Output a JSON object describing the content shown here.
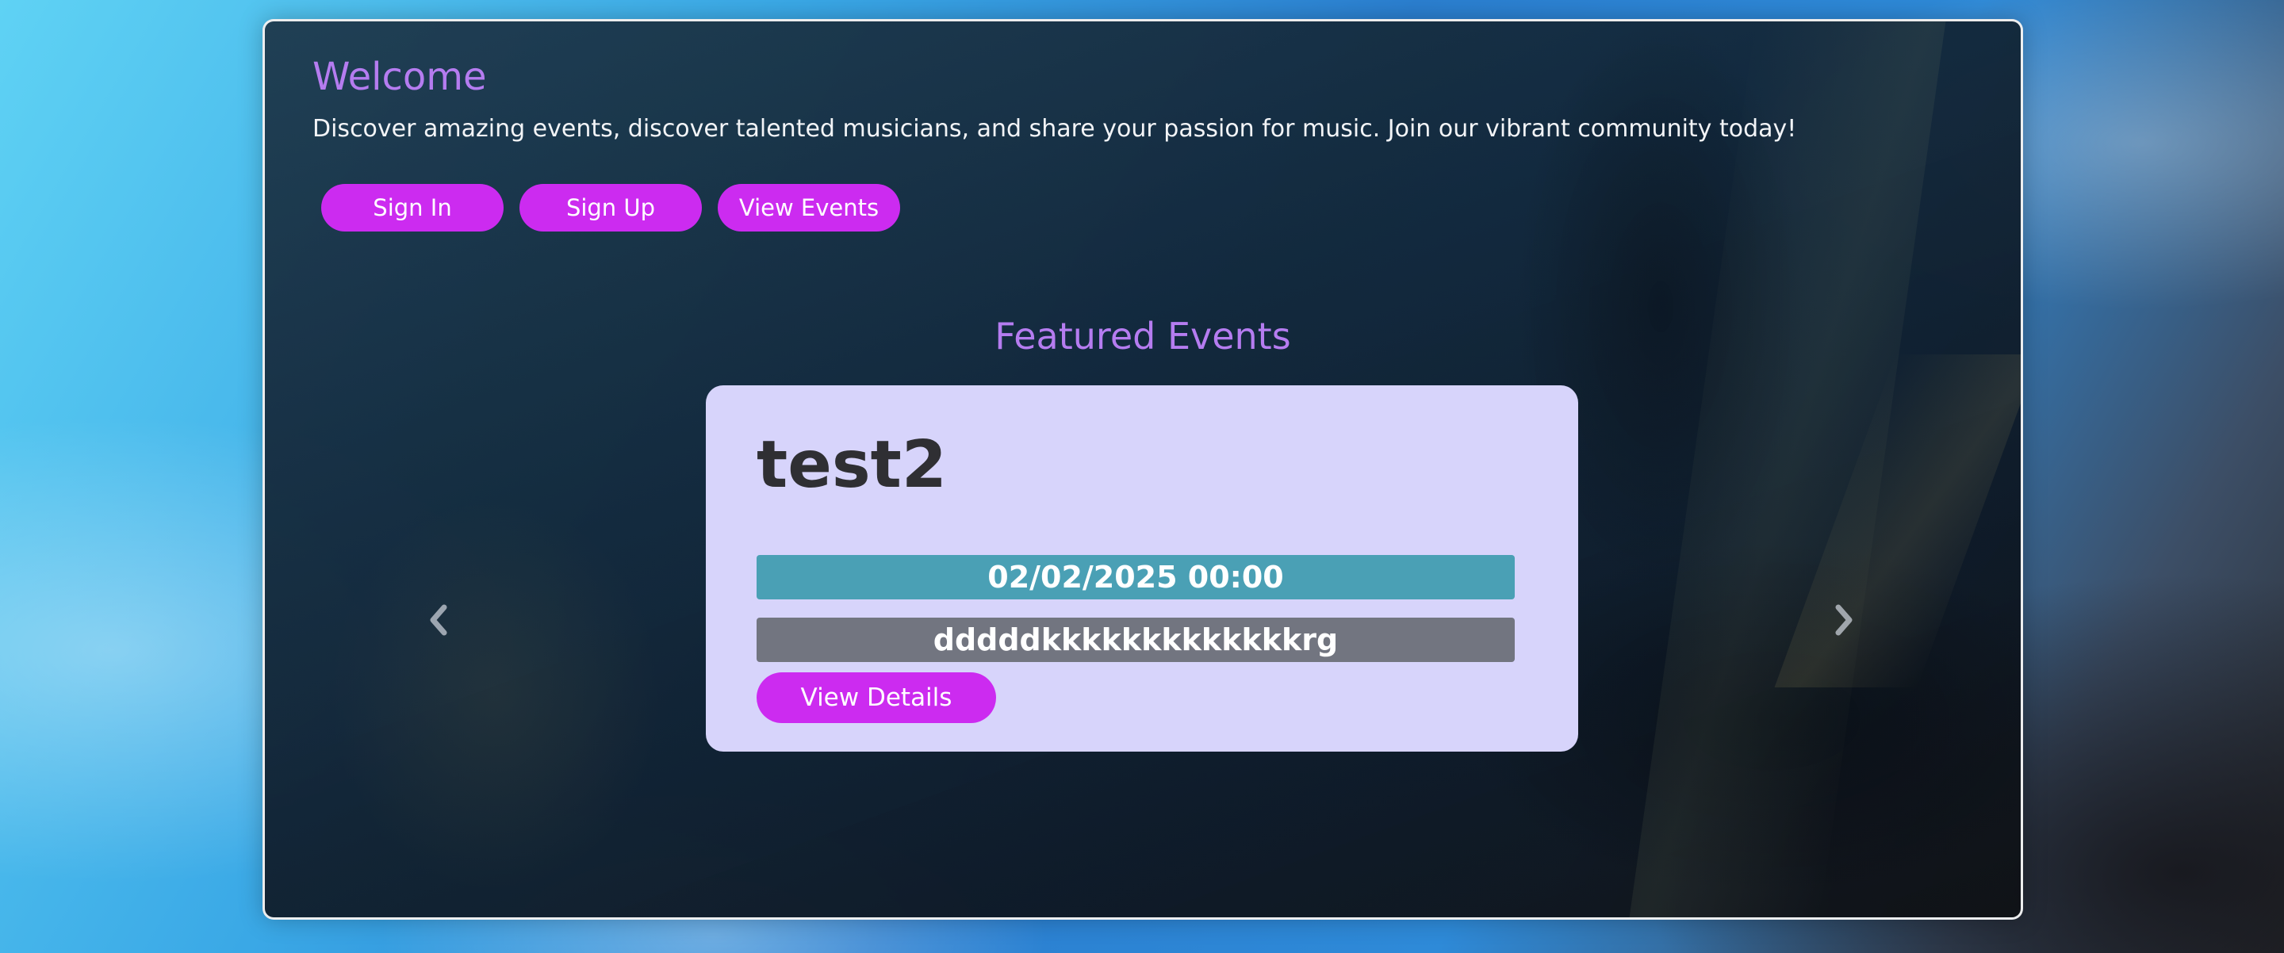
{
  "welcome": {
    "title": "Welcome",
    "text": "Discover amazing events, discover talented musicians, and share your passion for music. Join our vibrant community today!",
    "buttons": {
      "sign_in": "Sign In",
      "sign_up": "Sign Up",
      "view_events": "View Events"
    }
  },
  "featured": {
    "title": "Featured Events",
    "prev_icon": "chevron-left-icon",
    "next_icon": "chevron-right-icon",
    "event": {
      "name": "test2",
      "date": "02/02/2025 00:00",
      "description": "dddddkkkkkkkkkkkkkrg",
      "details_label": "View Details"
    }
  },
  "colors": {
    "accent_button": "#cc2bf0",
    "heading_purple": "#b57cf0",
    "card_background": "#d7d4fb",
    "date_bar": "#4aa0b5",
    "description_bar": "#727580"
  }
}
